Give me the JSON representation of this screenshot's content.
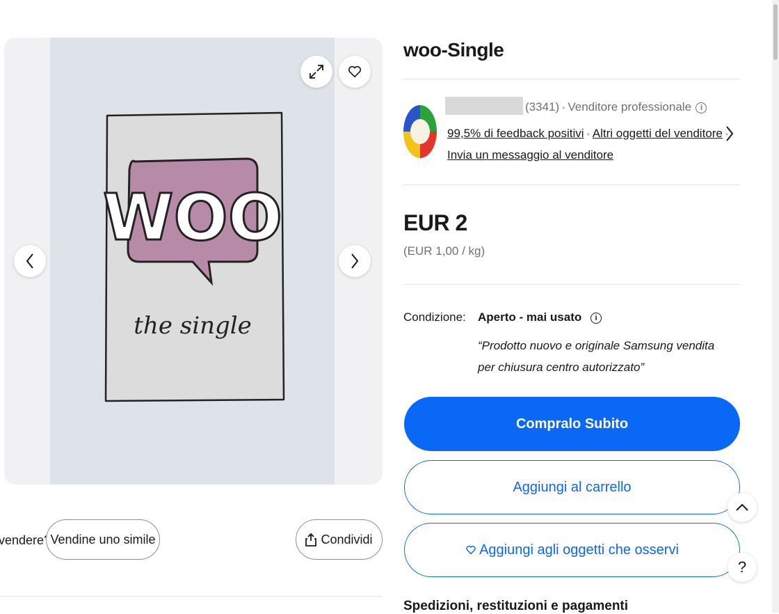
{
  "gallery": {
    "image_text": {
      "brand": "WOO",
      "subtitle": "the single"
    },
    "icons": {
      "expand": "expand-icon",
      "favorite": "heart-icon",
      "prev": "chevron-left-icon",
      "next": "chevron-right-icon"
    }
  },
  "below_gallery": {
    "sell_prompt_partial": "vendere?",
    "sell_similar_label": "Vendine uno simile",
    "share_label": "Condividi"
  },
  "product": {
    "title": "woo-Single"
  },
  "seller": {
    "feedback_count": "(3341)",
    "seller_type": "Venditore professionale",
    "feedback_link": "99,5% di feedback positivi",
    "other_items_link": "Altri oggetti del venditore",
    "message_link": "Invia un messaggio al venditore"
  },
  "price": {
    "main": "EUR 2",
    "unit": "(EUR 1,00 / kg)"
  },
  "condition": {
    "label": "Condizione:",
    "value": "Aperto - mai usato",
    "description": "“Prodotto nuovo e originale Samsung vendita per chiusura centro autorizzato”"
  },
  "actions": {
    "buy_now": "Compralo Subito",
    "add_to_cart": "Aggiungi al carrello",
    "watch": "Aggiungi agli oggetti che osservi"
  },
  "section_heading": "Spedizioni, restituzioni e pagamenti",
  "floating": {
    "back_to_top": "chevron-up-icon",
    "help": "?"
  },
  "colors": {
    "primary_blue": "#0968f6",
    "text": "#191919",
    "muted": "#707070",
    "woo_purple": "#b78aa8"
  }
}
